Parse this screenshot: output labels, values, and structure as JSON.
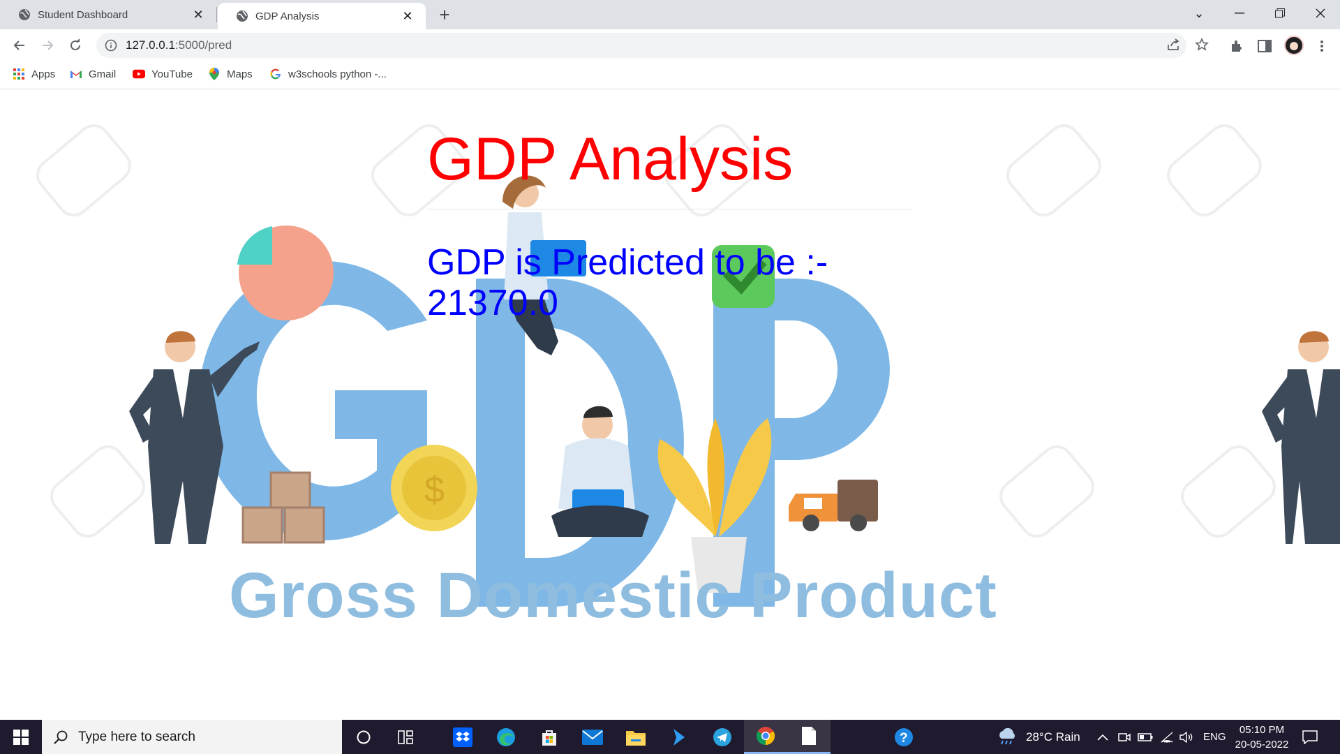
{
  "browser": {
    "tabs": [
      {
        "title": "Student Dashboard",
        "active": false
      },
      {
        "title": "GDP Analysis",
        "active": true
      }
    ],
    "new_tab_label": "+",
    "url_host": "127.0.0.1",
    "url_path": ":5000/pred",
    "bookmarks": [
      {
        "label": "Apps",
        "icon": "apps-grid-icon"
      },
      {
        "label": "Gmail",
        "icon": "gmail-icon"
      },
      {
        "label": "YouTube",
        "icon": "youtube-icon"
      },
      {
        "label": "Maps",
        "icon": "maps-icon"
      },
      {
        "label": "w3schools python -...",
        "icon": "google-icon"
      }
    ]
  },
  "page": {
    "heading": "GDP Analysis",
    "prediction_text": "GDP is Predicted to be :- 21370.0",
    "illustration_caption": "Gross Domestic Product",
    "colors": {
      "heading": "#ff0000",
      "prediction": "#0000ff",
      "illustration_blue": "#7fb8e6"
    }
  },
  "taskbar": {
    "search_placeholder": "Type here to search",
    "weather": "28°C  Rain",
    "language": "ENG",
    "time": "05:10 PM",
    "date": "20-05-2022",
    "pinned": [
      "cortana-icon",
      "task-view-icon",
      "dropbox-icon",
      "edge-icon",
      "store-icon",
      "mail-icon",
      "file-explorer-icon",
      "visual-studio-icon",
      "telegram-icon",
      "chrome-icon",
      "notepad-icon",
      "help-icon"
    ]
  }
}
